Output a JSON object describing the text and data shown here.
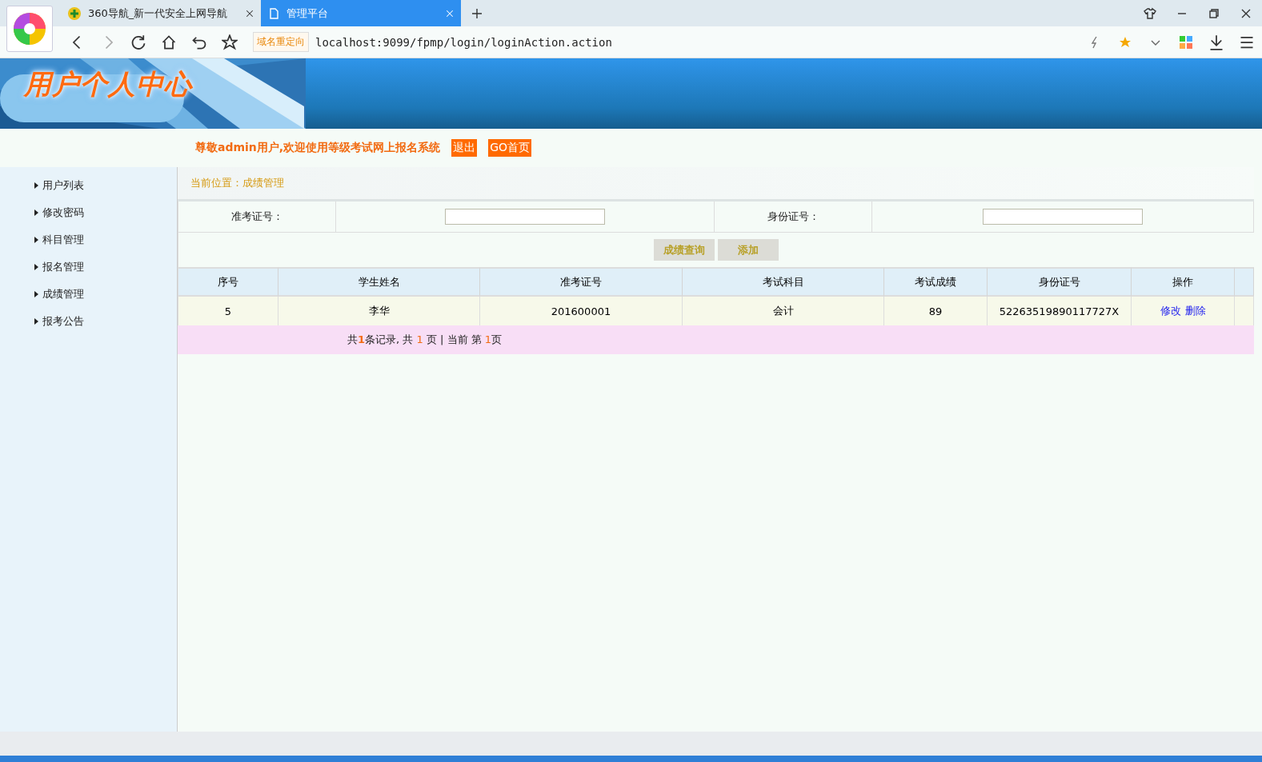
{
  "browser": {
    "tabs": [
      {
        "title": "360导航_新一代安全上网导航",
        "selected": false
      },
      {
        "title": "管理平台",
        "selected": true
      }
    ],
    "redirect_badge": "域名重定向",
    "url": "localhost:9099/fpmp/login/loginAction.action"
  },
  "banner": {
    "logo_text": "用户个人中心"
  },
  "welcome": {
    "message": "尊敬admin用户,欢迎使用等级考试网上报名系统",
    "buttons": [
      "退出",
      "GO首页"
    ]
  },
  "sidebar": {
    "items": [
      {
        "label": "用户列表",
        "selected": false
      },
      {
        "label": "修改密码",
        "selected": false
      },
      {
        "label": "科目管理",
        "selected": false
      },
      {
        "label": "报名管理",
        "selected": false
      },
      {
        "label": "成绩管理",
        "selected": false
      },
      {
        "label": "报考公告",
        "selected": false
      }
    ]
  },
  "breadcrumb": "当前位置：成绩管理",
  "search": {
    "fields": [
      {
        "label": "准考证号："
      },
      {
        "label": "身份证号："
      }
    ],
    "buttons": [
      "成绩查询",
      "添加"
    ]
  },
  "table": {
    "columns": [
      "序号",
      "学生姓名",
      "准考证号",
      "考试科目",
      "考试成绩",
      "身份证号",
      "操作"
    ],
    "rows": [
      {
        "cells": [
          "5",
          "李华",
          "201600001",
          "会计",
          "89",
          "52263519890117727X"
        ],
        "actions": [
          "修改",
          "删除"
        ]
      }
    ]
  },
  "pager": [
    {
      "text": "共",
      "kind": "text"
    },
    {
      "text": "1",
      "kind": "strong"
    },
    {
      "text": "条记录, 共 ",
      "kind": "text"
    },
    {
      "text": "1",
      "kind": "number"
    },
    {
      "text": " 页 | 当前 第 ",
      "kind": "text"
    },
    {
      "text": "1",
      "kind": "number"
    },
    {
      "text": "页",
      "kind": "text"
    }
  ]
}
